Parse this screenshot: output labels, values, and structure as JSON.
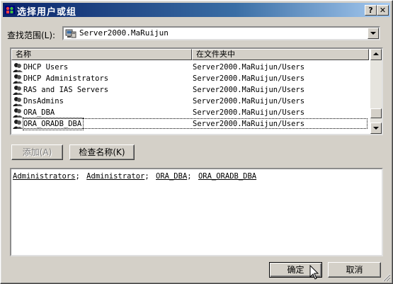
{
  "window": {
    "title": "选择用户或组",
    "help_label": "?",
    "close_label": "✕"
  },
  "lookin": {
    "label": "查找范围(L):",
    "value": "Server2000.MaRuijun"
  },
  "list": {
    "columns": [
      "名称",
      "在文件夹中"
    ],
    "rows": [
      {
        "name": "DHCP Users",
        "folder": "Server2000.MaRuijun/Users"
      },
      {
        "name": "DHCP Administrators",
        "folder": "Server2000.MaRuijun/Users"
      },
      {
        "name": "RAS and IAS Servers",
        "folder": "Server2000.MaRuijun/Users"
      },
      {
        "name": "DnsAdmins",
        "folder": "Server2000.MaRuijun/Users"
      },
      {
        "name": "ORA_DBA",
        "folder": "Server2000.MaRuijun/Users"
      },
      {
        "name": "ORA_ORADB_DBA",
        "folder": "Server2000.MaRuijun/Users"
      }
    ]
  },
  "actions": {
    "add_label": "添加(A)",
    "check_names_label": "检查名称(K)"
  },
  "selected": {
    "items": [
      "Administrators",
      "Administrator",
      "ORA_DBA",
      "ORA_ORADB_DBA"
    ],
    "separator": ";"
  },
  "footer": {
    "ok_label": "确定",
    "cancel_label": "取消"
  },
  "colors": {
    "title_start": "#0a246a",
    "title_end": "#a6caf0",
    "face": "#d4d0c8"
  }
}
